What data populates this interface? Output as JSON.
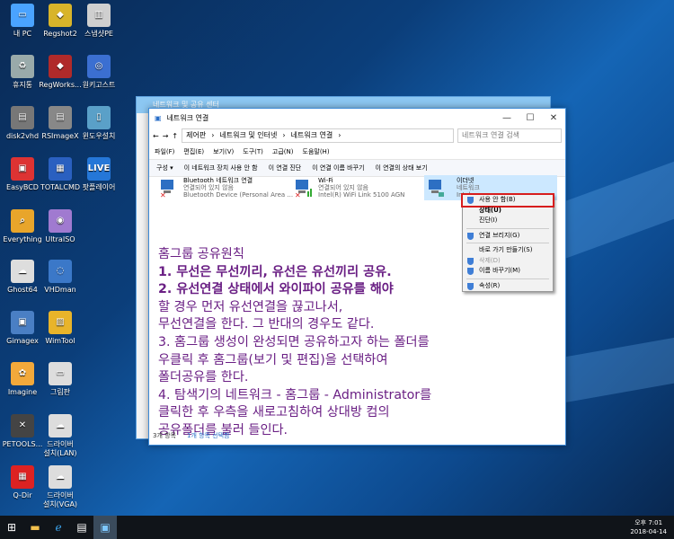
{
  "desktop": {
    "icons": [
      {
        "label": "내 PC",
        "color": "#4aa3ff",
        "glyph": "▭"
      },
      {
        "label": "Regshot2",
        "color": "#d8b42a",
        "glyph": "◆"
      },
      {
        "label": "스냅샷PE",
        "color": "#cfcfcf",
        "glyph": "▥"
      },
      {
        "label": "휴지통",
        "color": "#9aa",
        "glyph": "♻"
      },
      {
        "label": "RegWorks...",
        "color": "#b02a2a",
        "glyph": "◆"
      },
      {
        "label": "원키고스트",
        "color": "#3b6fd1",
        "glyph": "◎"
      },
      {
        "label": "disk2vhd",
        "color": "#777",
        "glyph": "▤"
      },
      {
        "label": "RSImageX",
        "color": "#888",
        "glyph": "▤"
      },
      {
        "label": "윈도우설치",
        "color": "#5aa0c8",
        "glyph": "▯"
      },
      {
        "label": "EasyBCD",
        "color": "#d33",
        "glyph": "▣"
      },
      {
        "label": "TOTALCMD",
        "color": "#2a60c0",
        "glyph": "▦"
      },
      {
        "label": "팟플레이어",
        "color": "#2577d8",
        "glyph": "LIVE"
      },
      {
        "label": "Everything",
        "color": "#e8a52b",
        "glyph": "⌕"
      },
      {
        "label": "UltraISO",
        "color": "#a07ad0",
        "glyph": "◉"
      },
      {
        "label": "Ghost64",
        "color": "#ddd",
        "glyph": "☁"
      },
      {
        "label": "VHDman",
        "color": "#3b78c8",
        "glyph": "◌"
      },
      {
        "label": "Gimagex",
        "color": "#4a7fc4",
        "glyph": "▣"
      },
      {
        "label": "WimTool",
        "color": "#e8b42a",
        "glyph": "▨"
      },
      {
        "label": "Imagine",
        "color": "#f2a93b",
        "glyph": "✿"
      },
      {
        "label": "그림판",
        "color": "#ddd",
        "glyph": "▭"
      },
      {
        "label": "PETOOLS...",
        "color": "#444",
        "glyph": "✕"
      },
      {
        "label": "드라이버\n설치(LAN)",
        "color": "#ddd",
        "glyph": "☁"
      },
      {
        "label": "Q-Dir",
        "color": "#d22",
        "glyph": "▦"
      },
      {
        "label": "드라이버\n설치(VGA)",
        "color": "#ddd",
        "glyph": "☁"
      }
    ]
  },
  "back_window": {
    "title": "네트워크 및 공유 센터"
  },
  "window": {
    "title": "네트워크 연결",
    "breadcrumb": [
      "제어판",
      "네트워크 및 인터넷",
      "네트워크 연결"
    ],
    "search_placeholder": "네트워크 연결 검색",
    "menu": [
      "파일(F)",
      "편집(E)",
      "보기(V)",
      "도구(T)",
      "고급(N)",
      "도움말(H)"
    ],
    "commands": [
      "구성 ▾",
      "이 네트워크 장치 사용 안 함",
      "이 연결 진단",
      "이 연결 이름 바꾸기",
      "이 연결의 상태 보기"
    ],
    "connections": [
      {
        "name": "Bluetooth 네트워크 연결",
        "status": "연결되어 있지 않음",
        "device": "Bluetooth Device (Personal Area ..."
      },
      {
        "name": "Wi-Fi",
        "status": "연결되어 있지 않음",
        "device": "Intel(R) WiFi Link 5100 AGN"
      },
      {
        "name": "이더넷",
        "status": "네트워크",
        "device": "Intel..."
      }
    ],
    "status_count": "3개 항목",
    "status_selected": "1개 항목 선택함"
  },
  "context_menu": [
    {
      "label": "사용 안 함(B)",
      "shield": true
    },
    {
      "label": "상태(U)",
      "shield": false,
      "bold": true
    },
    {
      "label": "진단(I)",
      "shield": false
    },
    {
      "label": "연결 브리지(G)",
      "shield": true
    },
    {
      "label": "바로 가기 만들기(S)",
      "shield": false
    },
    {
      "label": "삭제(D)",
      "shield": true,
      "disabled": true
    },
    {
      "label": "이름 바꾸기(M)",
      "shield": true
    },
    {
      "label": "속성(R)",
      "shield": true
    }
  ],
  "overlay_text": [
    "홈그룹 공유원칙",
    "1. 무선은 무선끼리, 유선은 유선끼리 공유.",
    "2. 유선연결 상태에서 와이파이 공유를 해야",
    "할 경우 먼저 유선연결을 끊고나서,",
    "무선연결을 한다. 그 반대의 경우도 같다.",
    "3. 홈그룹 생성이 완성되면 공유하고자 하는 폴더를",
    " 우클릭 후 홈그룹(보기 및 편집)을 선택하여",
    "폴더공유를 한다.",
    "4. 탐색기의 네트워크 - 홈그룹 - Administrator를",
    "클릭한 후 우측을 새로고침하여 상대방 컴의",
    "공유폴더를 불러 들인다."
  ],
  "taskbar": {
    "time": "오후 7:01",
    "date": "2018-04-14"
  }
}
